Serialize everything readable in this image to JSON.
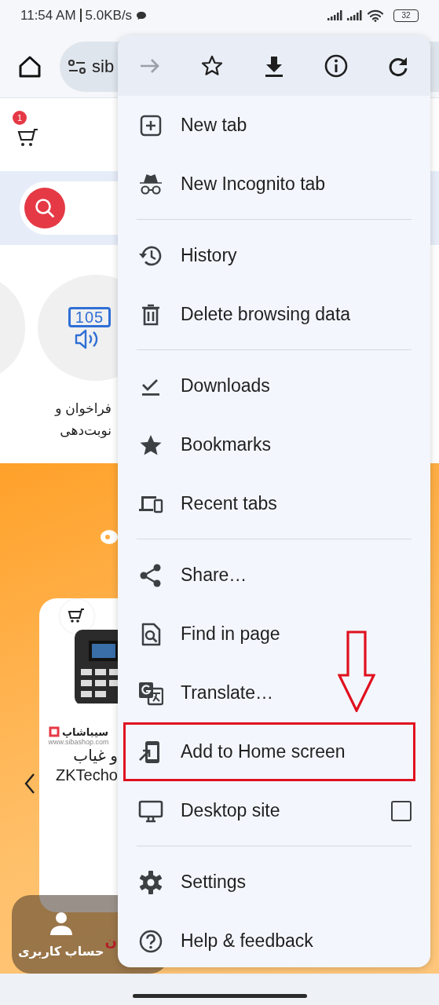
{
  "status_bar": {
    "time": "11:54 AM",
    "speed": "5.0KB/s",
    "battery": "32"
  },
  "toolbar": {
    "url": "sib"
  },
  "page": {
    "cart_count": "1",
    "category": {
      "icon_digits": "105",
      "label_lines": [
        "فراخوان و",
        "نوبت‌دهی"
      ]
    },
    "product": {
      "brand": "سیباشاپ",
      "brand_url": "www.sibashop.com",
      "title_lines": [
        "و غیاب",
        "ZKTecho"
      ]
    },
    "bottom_nav": {
      "label": "حساب کاربری",
      "partial": "ن"
    }
  },
  "menu": {
    "actions": [
      {
        "kind": "forward",
        "disabled": true
      },
      {
        "kind": "bookmark",
        "disabled": false
      },
      {
        "kind": "download",
        "disabled": false
      },
      {
        "kind": "info",
        "disabled": false
      },
      {
        "kind": "reload",
        "disabled": false
      }
    ],
    "sections": [
      [
        {
          "kind": "new-tab",
          "label": "New tab",
          "highlighted": false
        },
        {
          "kind": "incognito",
          "label": "New Incognito tab",
          "highlighted": false
        }
      ],
      [
        {
          "kind": "history",
          "label": "History",
          "highlighted": false
        },
        {
          "kind": "delete",
          "label": "Delete browsing data",
          "highlighted": false
        }
      ],
      [
        {
          "kind": "downloads",
          "label": "Downloads",
          "highlighted": false
        },
        {
          "kind": "bookmarks",
          "label": "Bookmarks",
          "highlighted": false
        },
        {
          "kind": "recent-tabs",
          "label": "Recent tabs",
          "highlighted": false
        }
      ],
      [
        {
          "kind": "share",
          "label": "Share…",
          "highlighted": false
        },
        {
          "kind": "find",
          "label": "Find in page",
          "highlighted": false
        },
        {
          "kind": "translate",
          "label": "Translate…",
          "highlighted": false
        },
        {
          "kind": "add-home",
          "label": "Add to Home screen",
          "highlighted": true
        },
        {
          "kind": "desktop",
          "label": "Desktop site",
          "highlighted": false,
          "checked": false
        }
      ],
      [
        {
          "kind": "settings",
          "label": "Settings",
          "highlighted": false
        },
        {
          "kind": "help",
          "label": "Help & feedback",
          "highlighted": false
        }
      ]
    ]
  },
  "annotations": [
    {
      "kind": "down-arrow"
    }
  ]
}
